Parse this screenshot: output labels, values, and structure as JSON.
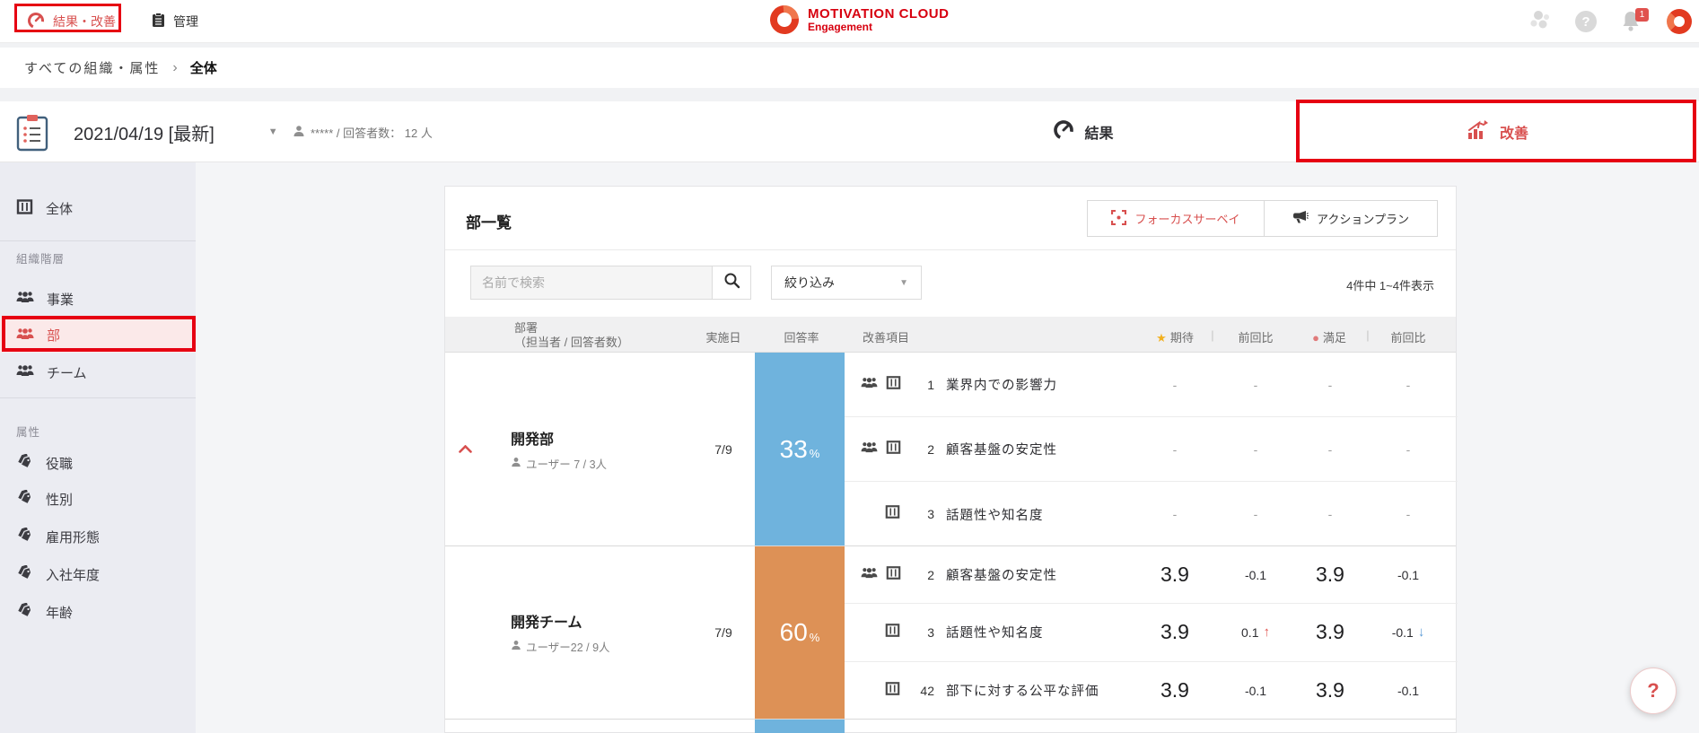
{
  "header": {
    "nav_results_improve": "結果・改善",
    "nav_admin": "管理",
    "logo_title": "MOTIVATION CLOUD",
    "logo_subtitle": "Engagement",
    "bell_badge": "1"
  },
  "breadcrumb": {
    "root": "すべての組織・属性",
    "separator": "›",
    "current": "全体"
  },
  "survey_bar": {
    "date": "2021/04/19 [最新]",
    "caret": "▼",
    "respondents": "***** / 回答者数： 12 人",
    "results_tab": "結果",
    "improve_tab": "改善"
  },
  "sidebar": {
    "overall": "全体",
    "org_section": "組織階層",
    "org_items": [
      "事業",
      "部",
      "チーム"
    ],
    "attr_section": "属性",
    "attr_items": [
      "役職",
      "性別",
      "雇用形態",
      "入社年度",
      "年齢"
    ]
  },
  "main": {
    "title": "部一覧",
    "focus_survey_button": "フォーカスサーベイ",
    "action_plan_button": "アクションプラン",
    "search_placeholder": "名前で検索",
    "filter_label": "絞り込み",
    "filter_caret": "▼",
    "result_count": "4件中 1~4件表示",
    "help_button": "?",
    "table": {
      "col_dept_line1": "部署",
      "col_dept_line2": "（担当者 / 回答者数）",
      "col_date": "実施日",
      "col_rate": "回答率",
      "col_item": "改善項目",
      "star": "★",
      "dot": "●",
      "col_expect": "期待",
      "col_satisfy": "満足",
      "col_prev": "前回比",
      "col_sep": "|",
      "groups": [
        {
          "name": "開発部",
          "users": "ユーザー 7 / 3人",
          "date": "7/9",
          "rate": "33",
          "rate_unit": "%",
          "rows": [
            {
              "num": "1",
              "label": "業界内での影響力",
              "expect": "-",
              "expect_diff": "-",
              "satisfy": "-",
              "satisfy_diff": "-"
            },
            {
              "num": "2",
              "label": "顧客基盤の安定性",
              "expect": "-",
              "expect_diff": "-",
              "satisfy": "-",
              "satisfy_diff": "-"
            },
            {
              "num": "3",
              "label": "話題性や知名度",
              "expect": "-",
              "expect_diff": "-",
              "satisfy": "-",
              "satisfy_diff": "-"
            }
          ]
        },
        {
          "name": "開発チーム",
          "users": "ユーザー22 / 9人",
          "date": "7/9",
          "rate": "60",
          "rate_unit": "%",
          "rows": [
            {
              "num": "2",
              "label": "顧客基盤の安定性",
              "expect": "3.9",
              "expect_diff": "-0.1",
              "satisfy": "3.9",
              "satisfy_diff": "-0.1"
            },
            {
              "num": "3",
              "label": "話題性や知名度",
              "expect": "3.9",
              "expect_diff": "0.1",
              "expect_arrow": "↑",
              "satisfy": "3.9",
              "satisfy_diff": "-0.1",
              "satisfy_arrow": "↓"
            },
            {
              "num": "42",
              "label": "部下に対する公平な評価",
              "expect": "3.9",
              "expect_diff": "-0.1",
              "satisfy": "3.9",
              "satisfy_diff": "-0.1"
            }
          ]
        }
      ]
    }
  },
  "colors": {
    "accent_red": "#d8504f",
    "logo_red": "#d7000f",
    "annotation_red": "#e60012",
    "bar_blue": "#6fb3dd",
    "bar_orange": "#dd9156",
    "star_gold": "#f2b01e",
    "dot_pink": "#e07a7a",
    "arrow_up_red": "#e0524e",
    "arrow_down_blue": "#5b9bd5",
    "sidebar_selected_bg": "#fbe9e9"
  }
}
